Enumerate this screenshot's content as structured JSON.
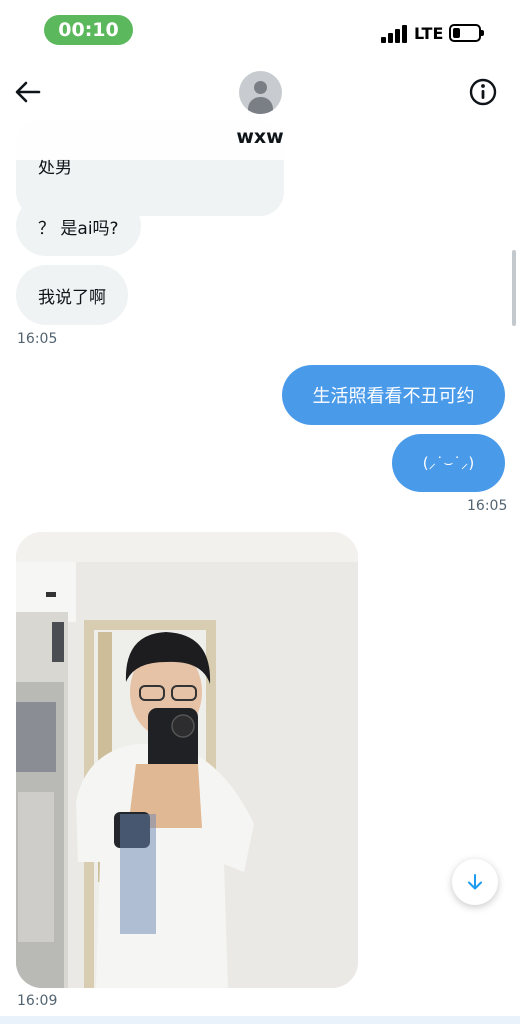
{
  "status_bar": {
    "time": "00:10",
    "network": "LTE"
  },
  "header": {
    "contact_name": "wxw",
    "icons": {
      "back": "arrow-left-icon",
      "info": "info-circle-icon"
    }
  },
  "messages": {
    "incoming_1": "处男",
    "incoming_2": "？ 是ai吗?",
    "incoming_3": "我说了啊",
    "incoming_time": "16:05",
    "outgoing_1": "生活照看看不丑可约",
    "outgoing_2": "(⸝˙⌣˙⸝)",
    "outgoing_time": "16:05",
    "photo_time": "16:09"
  },
  "colors": {
    "accent": "#4a9aea",
    "incoming_bubble": "#eff3f4",
    "time_pill": "#5cb85c"
  }
}
